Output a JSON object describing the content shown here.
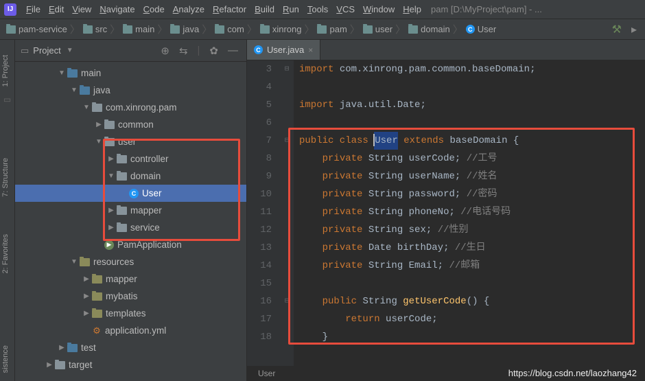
{
  "menu": {
    "items": [
      "File",
      "Edit",
      "View",
      "Navigate",
      "Code",
      "Analyze",
      "Refactor",
      "Build",
      "Run",
      "Tools",
      "VCS",
      "Window",
      "Help"
    ],
    "project_path": "pam [D:\\MyProject\\pam] - ..."
  },
  "breadcrumbs": {
    "items": [
      "pam-service",
      "src",
      "main",
      "java",
      "com",
      "xinrong",
      "pam",
      "user",
      "domain",
      "User"
    ]
  },
  "sidebar_tabs": {
    "project": "1: Project",
    "structure": "7: Structure",
    "favorites": "2: Favorites",
    "persistence": "sistence"
  },
  "project_panel": {
    "title": "Project"
  },
  "tree": [
    {
      "indent": 3,
      "arrow": "open",
      "icon": "folder-src",
      "label": "main"
    },
    {
      "indent": 4,
      "arrow": "open",
      "icon": "folder-src",
      "label": "java"
    },
    {
      "indent": 5,
      "arrow": "open",
      "icon": "folder-pkg",
      "label": "com.xinrong.pam"
    },
    {
      "indent": 6,
      "arrow": "closed",
      "icon": "folder-pkg",
      "label": "common"
    },
    {
      "indent": 6,
      "arrow": "open",
      "icon": "folder-pkg",
      "label": "user"
    },
    {
      "indent": 7,
      "arrow": "closed",
      "icon": "folder-pkg",
      "label": "controller"
    },
    {
      "indent": 7,
      "arrow": "open",
      "icon": "folder-pkg",
      "label": "domain"
    },
    {
      "indent": 8,
      "arrow": "none",
      "icon": "class",
      "label": "User",
      "selected": true
    },
    {
      "indent": 7,
      "arrow": "closed",
      "icon": "folder-pkg",
      "label": "mapper"
    },
    {
      "indent": 7,
      "arrow": "closed",
      "icon": "folder-pkg",
      "label": "service"
    },
    {
      "indent": 6,
      "arrow": "none",
      "icon": "app",
      "label": "PamApplication"
    },
    {
      "indent": 4,
      "arrow": "open",
      "icon": "folder-res",
      "label": "resources"
    },
    {
      "indent": 5,
      "arrow": "closed",
      "icon": "folder-res",
      "label": "mapper"
    },
    {
      "indent": 5,
      "arrow": "closed",
      "icon": "folder-res",
      "label": "mybatis"
    },
    {
      "indent": 5,
      "arrow": "closed",
      "icon": "folder-res",
      "label": "templates"
    },
    {
      "indent": 5,
      "arrow": "none",
      "icon": "yml",
      "label": "application.yml"
    },
    {
      "indent": 3,
      "arrow": "closed",
      "icon": "folder-src",
      "label": "test"
    },
    {
      "indent": 2,
      "arrow": "closed",
      "icon": "folder",
      "label": "target"
    }
  ],
  "editor": {
    "tab": {
      "label": "User.java"
    },
    "line_numbers": [
      3,
      4,
      5,
      6,
      7,
      8,
      9,
      10,
      11,
      12,
      13,
      14,
      15,
      16,
      17,
      18
    ],
    "code_lines": [
      {
        "raw": "import com.xinrong.pam.common.baseDomain;",
        "html": "<span class='k'>import</span> <span class='t'>com.xinrong.pam.common.baseDomain;</span>"
      },
      {
        "raw": "",
        "html": ""
      },
      {
        "raw": "import java.util.Date;",
        "html": "<span class='k'>import</span> <span class='t'>java.util.Date;</span>"
      },
      {
        "raw": "",
        "html": ""
      },
      {
        "raw": "public class User extends baseDomain {",
        "html": "<span class='k'>public class</span> <span class='code-highlight'><span class='cursor'></span><span class='n'>User</span></span> <span class='k'>extends</span> <span class='t'>baseDomain</span> <span class='t'>{</span>"
      },
      {
        "raw": "    private String userCode; //工号",
        "html": "    <span class='k'>private</span> <span class='t'>String</span> <span class='n'>userCode</span><span class='t'>;</span> <span class='c'>//工号</span>"
      },
      {
        "raw": "    private String userName; //姓名",
        "html": "    <span class='k'>private</span> <span class='t'>String</span> <span class='n'>userName</span><span class='t'>;</span> <span class='c'>//姓名</span>"
      },
      {
        "raw": "    private String password; //密码",
        "html": "    <span class='k'>private</span> <span class='t'>String</span> <span class='n'>password</span><span class='t'>;</span> <span class='c'>//密码</span>"
      },
      {
        "raw": "    private String phoneNo; //电话号码",
        "html": "    <span class='k'>private</span> <span class='t'>String</span> <span class='n'>phoneNo</span><span class='t'>;</span> <span class='c'>//电话号码</span>"
      },
      {
        "raw": "    private String sex; //性别",
        "html": "    <span class='k'>private</span> <span class='t'>String</span> <span class='n'>sex</span><span class='t'>;</span> <span class='c'>//性别</span>"
      },
      {
        "raw": "    private Date birthDay; //生日",
        "html": "    <span class='k'>private</span> <span class='t'>Date</span> <span class='n'>birthDay</span><span class='t'>;</span> <span class='c'>//生日</span>"
      },
      {
        "raw": "    private String Email; //邮箱",
        "html": "    <span class='k'>private</span> <span class='t'>String</span> <span class='n'>Email</span><span class='t'>;</span> <span class='c'>//邮箱</span>"
      },
      {
        "raw": "",
        "html": ""
      },
      {
        "raw": "    public String getUserCode() {",
        "html": "    <span class='k'>public</span> <span class='t'>String</span> <span class='m'>getUserCode</span><span class='t'>() {</span>"
      },
      {
        "raw": "        return userCode;",
        "html": "        <span class='k'>return</span> <span class='n'>userCode</span><span class='t'>;</span>"
      },
      {
        "raw": "    }",
        "html": "    <span class='t'>}</span>"
      }
    ],
    "footer": "User",
    "fold_markers": {
      "0": "⊟",
      "4": "⊟",
      "13": "⊟"
    }
  },
  "watermark": "https://blog.csdn.net/laozhang42"
}
